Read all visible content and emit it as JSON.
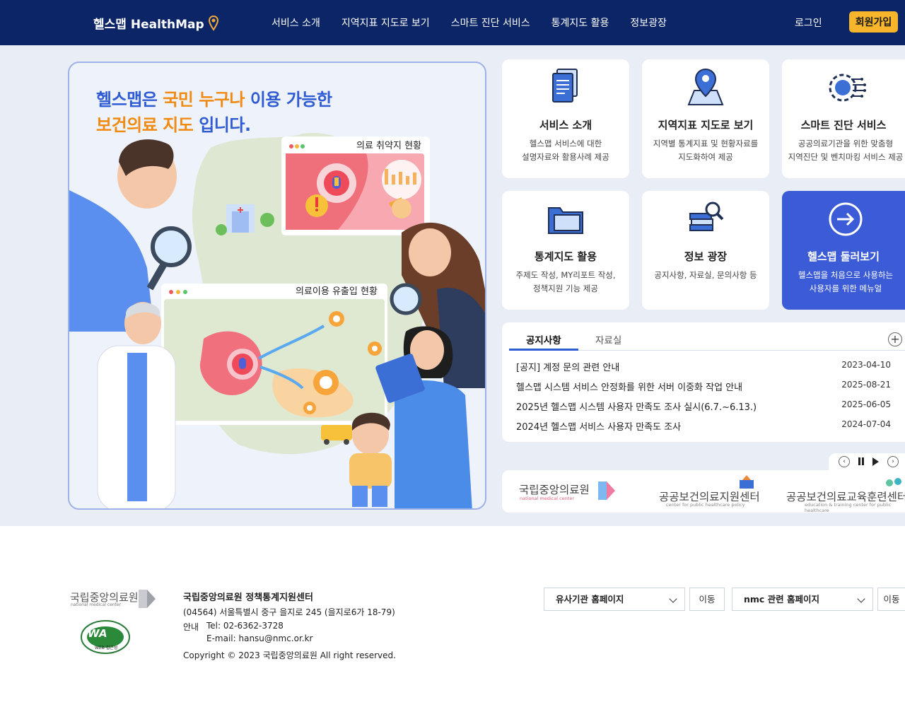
{
  "header": {
    "logo": "헬스맵 HealthMap",
    "nav": [
      "서비스 소개",
      "지역지표 지도로 보기",
      "스마트 진단 서비스",
      "통계지도 활용",
      "정보광장"
    ],
    "login": "로그인",
    "signup": "회원가입"
  },
  "hero": {
    "line1_a": "헬스맵은",
    "line1_b": "국민 누구나",
    "line1_c": "이용 가능한",
    "line2_a": "보건의료 지도",
    "line2_b": "입니다.",
    "panel1": "의료 취약지 현황",
    "panel2": "의료이용 유출입 현황"
  },
  "cards": [
    {
      "title": "서비스 소개",
      "desc": "헬스맵 서비스에 대한\n설명자료와 활용사례 제공",
      "icon": "document-icon"
    },
    {
      "title": "지역지표 지도로 보기",
      "desc": "지역별 통계지표 및 현황자료를\n지도화하여 제공",
      "icon": "map-pin-icon"
    },
    {
      "title": "스마트 진단 서비스",
      "desc": "공공의료기관을 위한 맞춤형\n지역진단 및 벤치마킹 서비스 제공",
      "icon": "gear-circuit-icon"
    },
    {
      "title": "통계지도 활용",
      "desc": "주제도 작성, MY리포트 작성,\n정책지원 기능 제공",
      "icon": "folder-icon"
    },
    {
      "title": "정보 광장",
      "desc": "공지사항, 자료실, 문의사항 등",
      "icon": "books-search-icon"
    },
    {
      "title": "헬스맵 둘러보기",
      "desc": "헬스맵을 처음으로 사용하는\n사용자를 위한 메뉴얼",
      "icon": "arrow-circle-icon"
    }
  ],
  "notice": {
    "tab_on": "공지사항",
    "tab_off": "자료실",
    "plus": "+",
    "rows": [
      {
        "title": "[공지] 계정 문의 관련 안내",
        "date": "2023-04-10"
      },
      {
        "title": "헬스맵 시스템 서비스 안정화를 위한 서버 이중화 작업 안내",
        "date": "2025-08-21"
      },
      {
        "title": "2025년 헬스맵 시스템 사용자 만족도 조사 실시(6.7.~6.13.)",
        "date": "2025-06-05"
      },
      {
        "title": "2024년 헬스맵 서비스 사용자 만족도 조사",
        "date": "2024-07-04"
      }
    ]
  },
  "banner": {
    "org1": "국립중앙의료원",
    "org1_sub": "national medical center",
    "org2": "공공보건의료지원센터",
    "org2_sub": "center for public healthcare policy",
    "org3": "공공보건의료교육훈련센터",
    "org3_sub": "education & training center for public healthcare"
  },
  "footer": {
    "logo": "국립중앙의료원",
    "logo_sub": "national medical center",
    "wa_badge": "WA",
    "wa_sub": "WEB 접근성",
    "org": "국립중앙의료원 정책통계지원센터",
    "address": "(04564) 서울특별시 중구 을지로 245 (을지로6가 18-79)",
    "guide": "안내",
    "tel": "Tel: 02-6362-3728",
    "email": "E-mail: hansu@nmc.or.kr",
    "copyright": "Copyright © 2023 국립중앙의료원 All right reserved.",
    "select1": "유사기관 홈페이지",
    "select2": "nmc 관련 홈페이지",
    "go": "이동"
  },
  "colors": {
    "header": "#0b2566",
    "accent": "#2f5bd3",
    "orange": "#f08a12",
    "signup": "#f7b52b",
    "active_card": "#3c5bd6"
  }
}
